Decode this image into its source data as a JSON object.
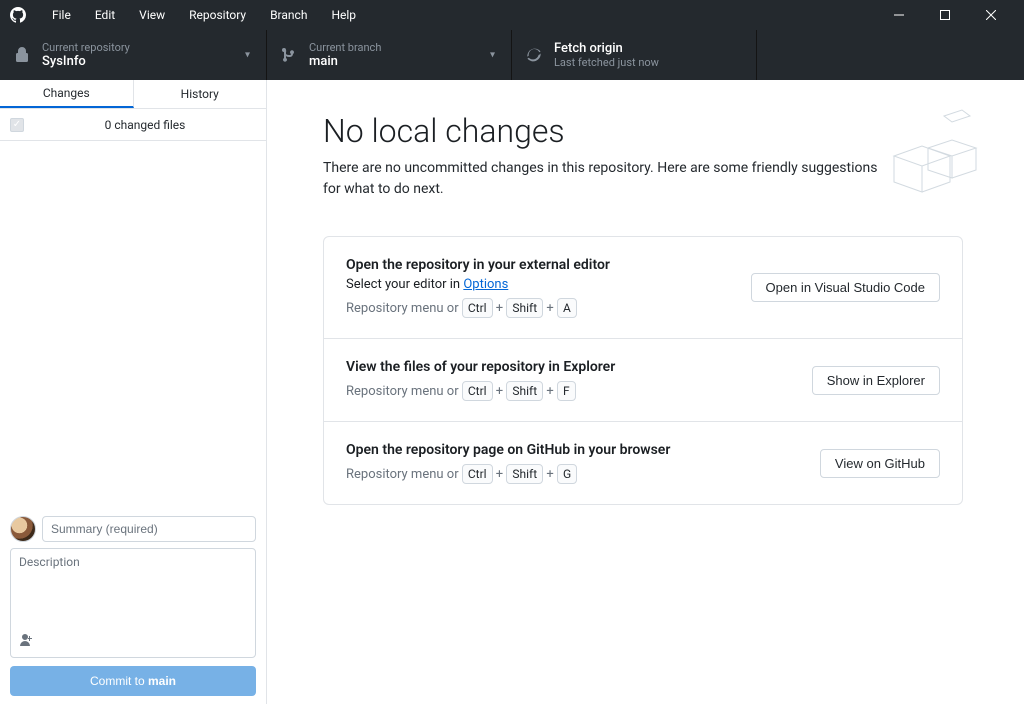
{
  "menubar": [
    "File",
    "Edit",
    "View",
    "Repository",
    "Branch",
    "Help"
  ],
  "toolbar": {
    "repo": {
      "label": "Current repository",
      "value": "SysInfo"
    },
    "branch": {
      "label": "Current branch",
      "value": "main"
    },
    "fetch": {
      "label": "Fetch origin",
      "value": "Last fetched just now"
    }
  },
  "tabs": {
    "changes": "Changes",
    "history": "History"
  },
  "changes_header": "0 changed files",
  "commit": {
    "summary_placeholder": "Summary (required)",
    "description_placeholder": "Description",
    "button_prefix": "Commit to ",
    "button_branch": "main"
  },
  "content": {
    "heading": "No local changes",
    "sub": "There are no uncommitted changes in this repository. Here are some friendly suggestions for what to do next.",
    "card1": {
      "title": "Open the repository in your external editor",
      "sub_prefix": "Select your editor in ",
      "sub_link": "Options",
      "shortcut_prefix": "Repository menu or ",
      "k1": "Ctrl",
      "k2": "Shift",
      "k3": "A",
      "btn": "Open in Visual Studio Code"
    },
    "card2": {
      "title": "View the files of your repository in Explorer",
      "shortcut_prefix": "Repository menu or ",
      "k1": "Ctrl",
      "k2": "Shift",
      "k3": "F",
      "btn": "Show in Explorer"
    },
    "card3": {
      "title": "Open the repository page on GitHub in your browser",
      "shortcut_prefix": "Repository menu or ",
      "k1": "Ctrl",
      "k2": "Shift",
      "k3": "G",
      "btn": "View on GitHub"
    }
  }
}
